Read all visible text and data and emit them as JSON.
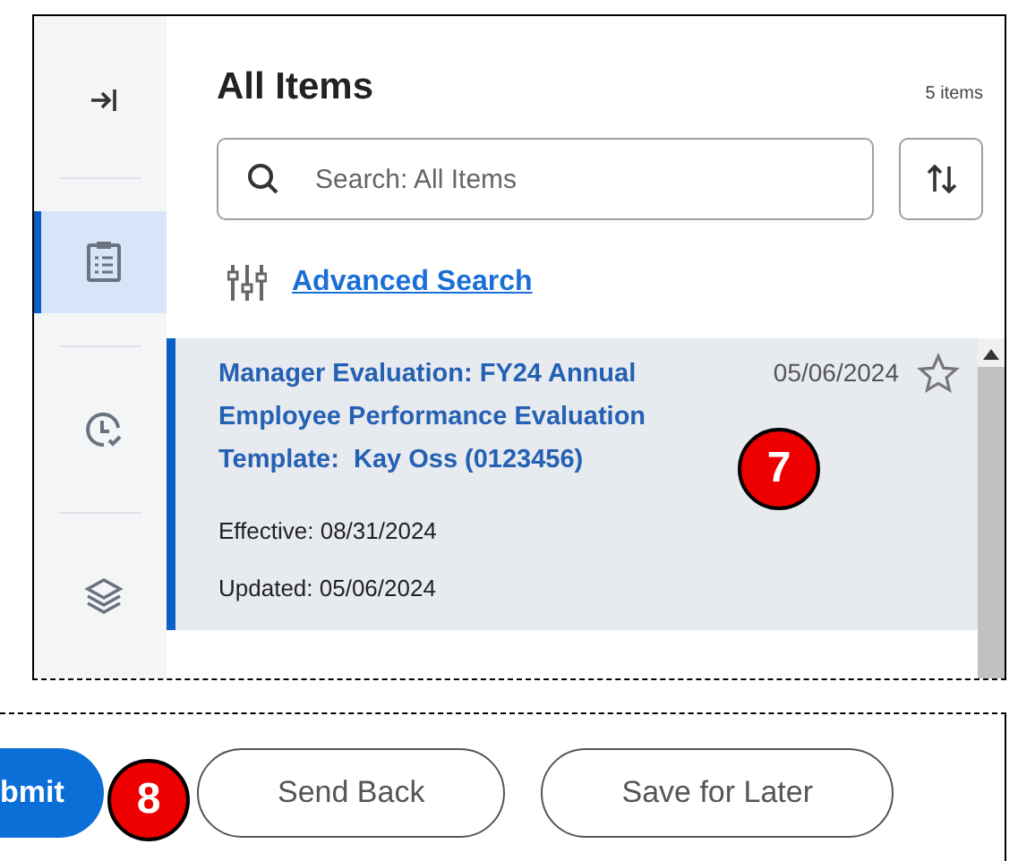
{
  "sidebar": {
    "items": [
      {
        "kind": "collapse",
        "selected": false
      },
      {
        "kind": "clipboard",
        "selected": true
      },
      {
        "kind": "history",
        "selected": false
      },
      {
        "kind": "layers",
        "selected": false
      }
    ]
  },
  "header": {
    "title": "All Items",
    "count": "5 items"
  },
  "search": {
    "placeholder": "Search: All Items"
  },
  "advanced_search": "Advanced Search",
  "items": [
    {
      "title": "Manager Evaluation: FY24 Annual Employee Performance Evaluation Template:  Kay Oss (0123456)",
      "date": "05/06/2024",
      "effective": "Effective: 08/31/2024",
      "updated": "Updated: 05/06/2024",
      "starred": false,
      "selected": true,
      "callout": "7"
    }
  ],
  "buttons": [
    {
      "label": "bmit",
      "kind": "primary"
    },
    {
      "label": "Send Back",
      "kind": "secondary"
    },
    {
      "label": "Save for Later",
      "kind": "secondary"
    }
  ],
  "button_callout": "8"
}
